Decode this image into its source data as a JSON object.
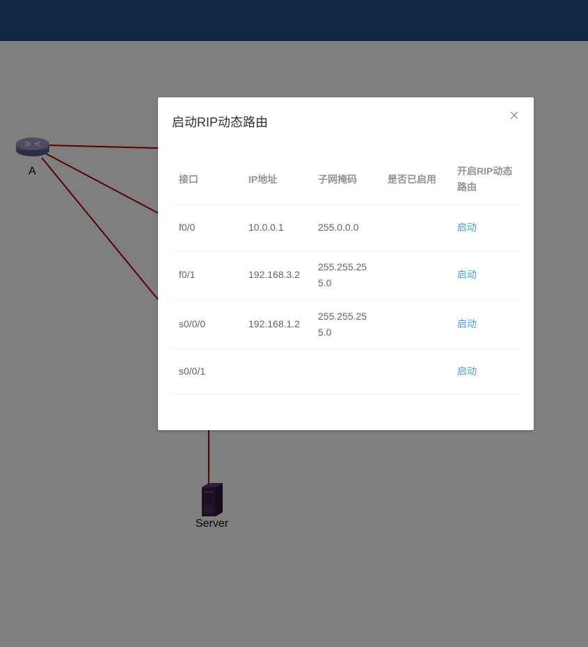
{
  "topology": {
    "nodes": [
      {
        "id": "A",
        "label": "A",
        "kind": "router"
      },
      {
        "id": "Server",
        "label": "Server",
        "kind": "server"
      }
    ],
    "link_color": "#b00000"
  },
  "dialog": {
    "title": "启动RIP动态路由",
    "columns": [
      "接口",
      "IP地址",
      "子网掩码",
      "是否已启用",
      "开启RIP动态路由"
    ],
    "rows": [
      {
        "interface": "f0/0",
        "ip": "10.0.0.1",
        "mask": "255.0.0.0",
        "enabled": "",
        "action": "启动"
      },
      {
        "interface": "f0/1",
        "ip": "192.168.3.2",
        "mask": "255.255.255.0",
        "enabled": "",
        "action": "启动"
      },
      {
        "interface": "s0/0/0",
        "ip": "192.168.1.2",
        "mask": "255.255.255.0",
        "enabled": "",
        "action": "启动"
      },
      {
        "interface": "s0/0/1",
        "ip": "",
        "mask": "",
        "enabled": "",
        "action": "启动"
      }
    ]
  },
  "colors": {
    "header": "#1f4f83",
    "overlay": "rgba(0,0,0,0.5)",
    "link_action": "#409eff"
  }
}
